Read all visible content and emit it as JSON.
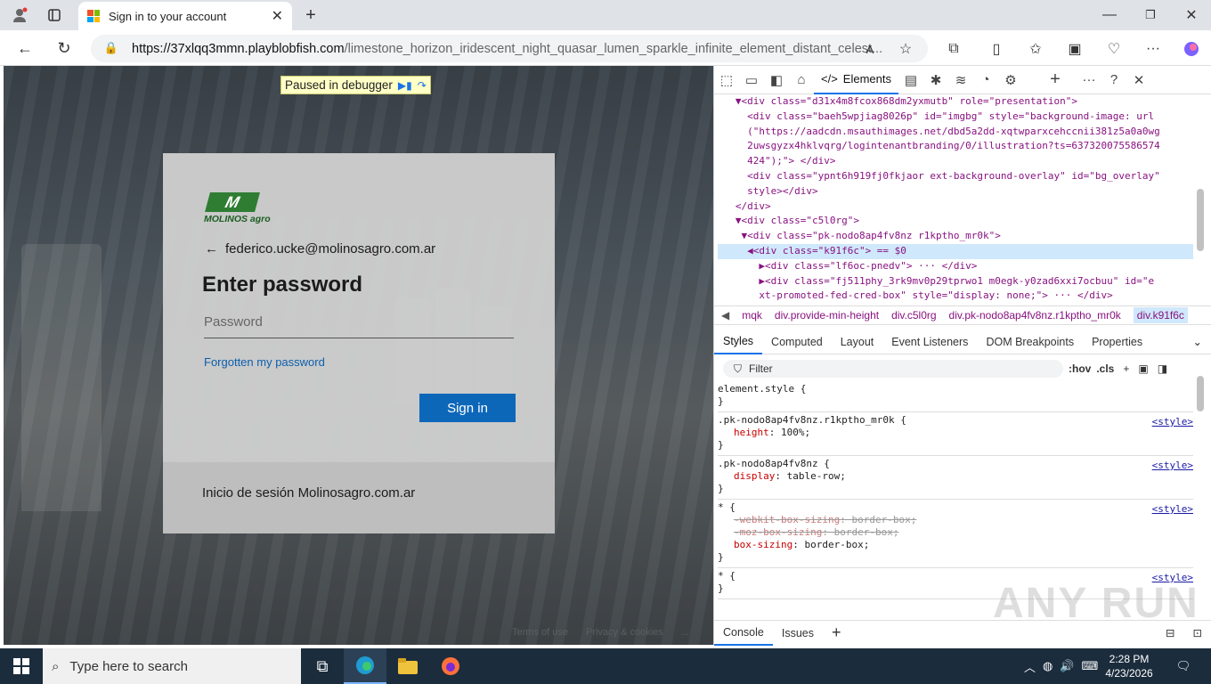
{
  "browser": {
    "tab_title": "Sign in to your account",
    "url_host": "https://37xlqq3mmn.playblobfish.com",
    "url_path": "/limestone_horizon_iridescent_night_quasar_lumen_sparkle_infinite_element_distant_celest..."
  },
  "debugger": {
    "paused_label": "Paused in debugger"
  },
  "login": {
    "brand": "MOLINOS agro",
    "email": "federico.ucke@molinosagro.com.ar",
    "heading": "Enter password",
    "password_placeholder": "Password",
    "forgot_link": "Forgotten my password",
    "signin_button": "Sign in",
    "footer_text": "Inicio de sesión Molinosagro.com.ar",
    "page_footer": [
      "Terms of use",
      "Privacy & cookies",
      "..."
    ]
  },
  "devtools": {
    "elements_tab": "Elements",
    "code_lines": [
      "▼<div class=\"d31x4m8fcox868dm2yxmutb\" role=\"presentation\">",
      "  <div class=\"baeh5wpjiag8026p\" id=\"imgbg\" style=\"background-image: url",
      "  (\"https://aadcdn.msauthimages.net/dbd5a2dd-xqtwparxcehccnii381z5a0a0wg",
      "  2uwsgyzx4hklvqrg/logintenantbranding/0/illustration?ts=637320075586574",
      "  424\");\"> </div>",
      "  <div class=\"ypnt6h919fj0fkjaor ext-background-overlay\" id=\"bg_overlay\"",
      "  style></div>",
      "</div>",
      "▼<div class=\"c5l0rg\">",
      " ▼<div class=\"pk-nodo8ap4fv8nz r1kptho_mr0k\">",
      "  ◀<div class=\"k91f6c\"> == $0",
      "    ▶<div class=\"lf6oc-pnedv\"> ··· </div>",
      "    ▶<div class=\"fj511phy_3rk9mv0p29tprwo1 m0egk-y0zad6xxi7ocbuu\" id=\"e",
      "    xt-promoted-fed-cred-box\" style=\"display: none;\"> ··· </div>"
    ],
    "breadcrumbs": [
      "mqk",
      "div.provide-min-height",
      "div.c5l0rg",
      "div.pk-nodo8ap4fv8nz.r1kptho_mr0k",
      "div.k91f6c"
    ],
    "style_tabs": [
      "Styles",
      "Computed",
      "Layout",
      "Event Listeners",
      "DOM Breakpoints",
      "Properties"
    ],
    "filter_placeholder": "Filter",
    "filter_actions": [
      ":hov",
      ".cls"
    ],
    "rules": [
      {
        "selector": "element.style {",
        "src": "",
        "props": []
      },
      {
        "selector": ".pk-nodo8ap4fv8nz.r1kptho_mr0k {",
        "src": "<style>",
        "props": [
          {
            "k": "height",
            "v": "100%;"
          }
        ]
      },
      {
        "selector": ".pk-nodo8ap4fv8nz {",
        "src": "<style>",
        "props": [
          {
            "k": "display",
            "v": "table-row;"
          }
        ]
      },
      {
        "selector": "* {",
        "src": "<style>",
        "props": [
          {
            "k": "-webkit-box-sizing",
            "v": "border-box;",
            "strike": true
          },
          {
            "k": "-moz-box-sizing",
            "v": "border-box;",
            "strike": true
          },
          {
            "k": "box-sizing",
            "v": "border-box;"
          }
        ]
      },
      {
        "selector": "* {",
        "src": "<style>",
        "props": []
      }
    ],
    "bottom_tabs": [
      "Console",
      "Issues"
    ]
  },
  "taskbar": {
    "search_placeholder": "Type here to search",
    "time": "2:28 PM",
    "date": "4/23/2026"
  },
  "watermark": "ANY RUN",
  "colors": {
    "signin_button": "#0d67b9",
    "link": "#0b5fad",
    "accent": "#1a73e8"
  }
}
